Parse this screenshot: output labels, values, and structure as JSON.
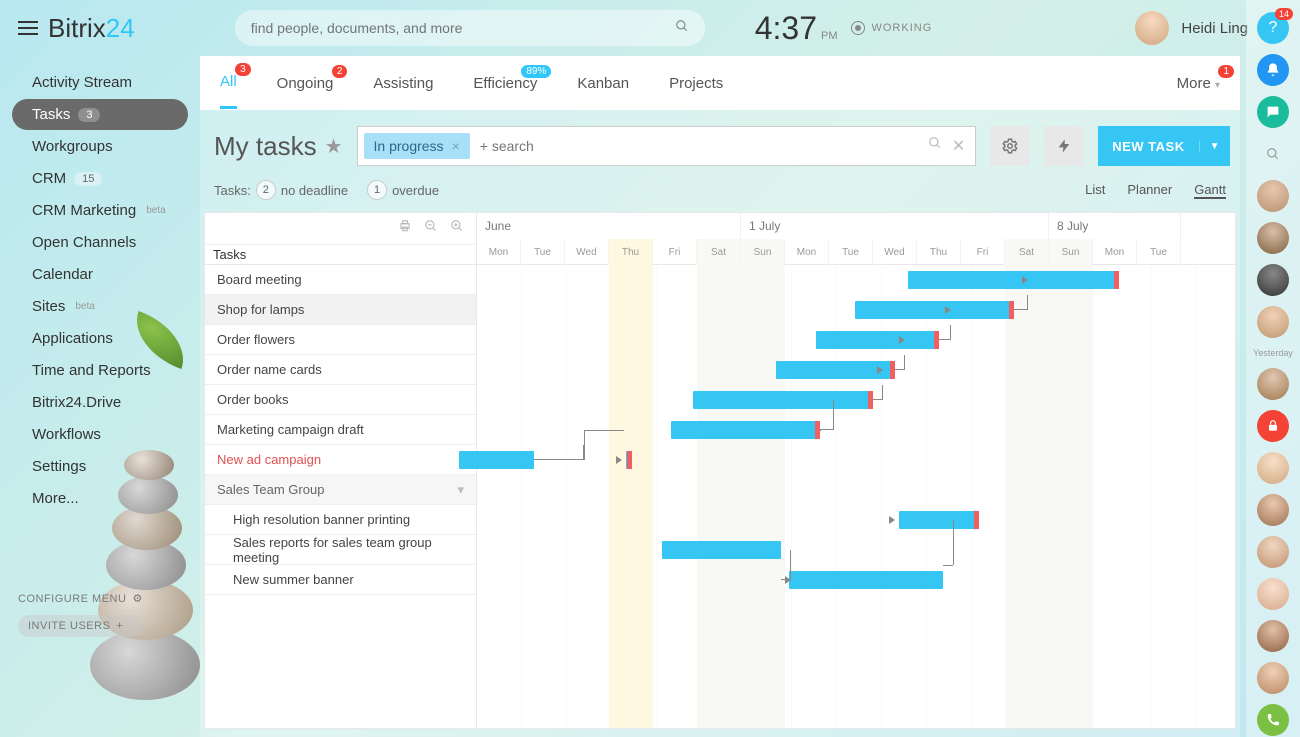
{
  "logo": {
    "a": "Bitrix",
    "b": "24"
  },
  "search_placeholder": "find people, documents, and more",
  "clock": {
    "time": "4:37",
    "period": "PM"
  },
  "working_label": "WORKING",
  "user": {
    "name": "Heidi Ling"
  },
  "help_badge": "14",
  "sidebar": {
    "items": [
      {
        "label": "Activity Stream"
      },
      {
        "label": "Tasks",
        "badge": "3",
        "active": true
      },
      {
        "label": "Workgroups"
      },
      {
        "label": "CRM",
        "badge": "15"
      },
      {
        "label": "CRM Marketing",
        "sup": "beta"
      },
      {
        "label": "Open Channels"
      },
      {
        "label": "Calendar"
      },
      {
        "label": "Sites",
        "sup": "beta"
      },
      {
        "label": "Applications"
      },
      {
        "label": "Time and Reports"
      },
      {
        "label": "Bitrix24.Drive"
      },
      {
        "label": "Workflows"
      },
      {
        "label": "Settings"
      },
      {
        "label": "More..."
      }
    ],
    "configure": "CONFIGURE MENU",
    "invite": "INVITE USERS"
  },
  "tabs": [
    {
      "label": "All",
      "badge": "3",
      "active": true
    },
    {
      "label": "Ongoing",
      "badge": "2"
    },
    {
      "label": "Assisting"
    },
    {
      "label": "Efficiency",
      "badge": "89%",
      "badge_style": "blue"
    },
    {
      "label": "Kanban"
    },
    {
      "label": "Projects"
    }
  ],
  "tabs_more": {
    "label": "More",
    "badge": "1"
  },
  "page_title": "My tasks",
  "filter_chip": "In progress",
  "filter_placeholder": "+ search",
  "new_task_label": "NEW TASK",
  "summary": {
    "prefix": "Tasks:",
    "no_deadline_n": "2",
    "no_deadline": "no deadline",
    "overdue_n": "1",
    "overdue": "overdue"
  },
  "views": {
    "list": "List",
    "planner": "Planner",
    "gantt": "Gantt"
  },
  "gantt": {
    "tasks_header": "Tasks",
    "months": [
      {
        "label": "June",
        "cols": 6
      },
      {
        "label": "1 July",
        "cols": 7
      },
      {
        "label": "8 July",
        "cols": 3
      }
    ],
    "days": [
      "Mon",
      "Tue",
      "Wed",
      "Thu",
      "Fri",
      "Sat",
      "Sun",
      "Mon",
      "Tue",
      "Wed",
      "Thu",
      "Fri",
      "Sat",
      "Sun",
      "Mon",
      "Tue"
    ],
    "weekend_cols": [
      5,
      6,
      12,
      13
    ],
    "today_col": 3,
    "rows": [
      {
        "label": "Board meeting"
      },
      {
        "label": "Shop for lamps",
        "sel": true
      },
      {
        "label": "Order flowers"
      },
      {
        "label": "Order name cards"
      },
      {
        "label": "Order books"
      },
      {
        "label": "Marketing campaign draft"
      },
      {
        "label": "New ad campaign",
        "red": true
      },
      {
        "label": "Sales Team Group",
        "grp": true
      },
      {
        "label": "High resolution banner printing",
        "sub": true
      },
      {
        "label": "Sales reports for sales team group meeting",
        "sub": true
      },
      {
        "label": "New summer banner",
        "sub": true
      }
    ],
    "bars": [
      {
        "row": 0,
        "start": 9.8,
        "end": 14.6,
        "tip": true
      },
      {
        "row": 1,
        "start": 8.6,
        "end": 12.2,
        "tip": true
      },
      {
        "row": 2,
        "start": 7.7,
        "end": 10.5,
        "tip": true
      },
      {
        "row": 3,
        "start": 6.8,
        "end": 9.5,
        "tip": true
      },
      {
        "row": 4,
        "start": 4.9,
        "end": 9.0,
        "tip": true
      },
      {
        "row": 5,
        "start": 4.4,
        "end": 7.8,
        "tip": true
      },
      {
        "row": 6,
        "start": -0.4,
        "end": 1.3
      },
      {
        "row": 6,
        "start": 3.38,
        "end": 3.52,
        "tip": true
      },
      {
        "row": 8,
        "start": 9.6,
        "end": 11.4,
        "tip": true
      },
      {
        "row": 9,
        "start": 4.2,
        "end": 6.9
      },
      {
        "row": 10,
        "start": 7.1,
        "end": 10.6
      }
    ]
  },
  "rail_yesterday": "Yesterday"
}
